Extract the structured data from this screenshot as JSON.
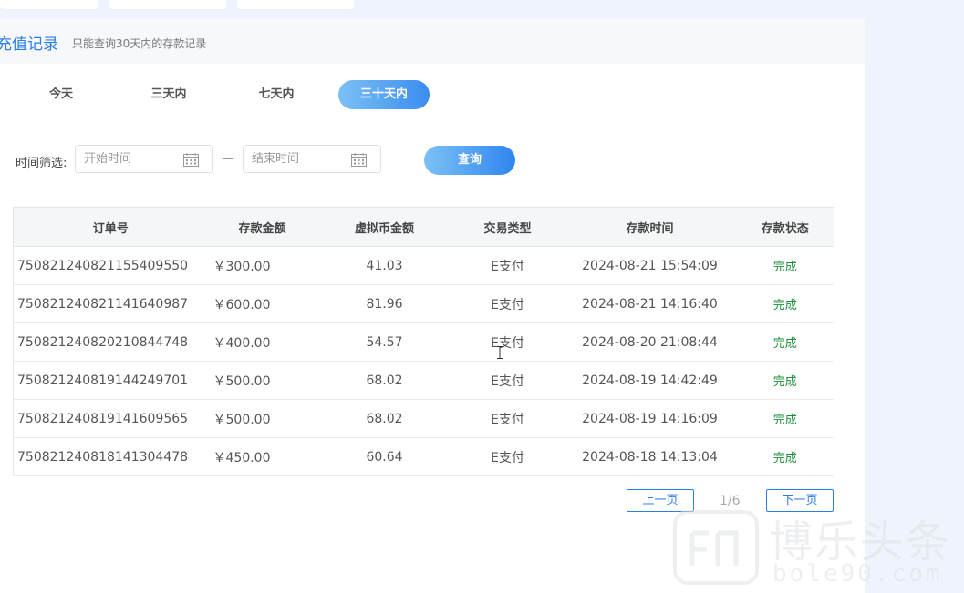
{
  "header": {
    "title": "充值记录",
    "subtitle": "只能查询30天内的存款记录"
  },
  "range_tabs": [
    {
      "label": "今天",
      "active": false
    },
    {
      "label": "三天内",
      "active": false
    },
    {
      "label": "七天内",
      "active": false
    },
    {
      "label": "三十天内",
      "active": true
    }
  ],
  "filter": {
    "label": "时间筛选:",
    "start_placeholder": "开始时间",
    "separator": "—",
    "end_placeholder": "结束时间",
    "query_label": "查询"
  },
  "table": {
    "columns": [
      "订单号",
      "存款金额",
      "虚拟币金额",
      "交易类型",
      "存款时间",
      "存款状态"
    ],
    "rows": [
      [
        "750821240821155409550",
        "￥300.00",
        "41.03",
        "E支付",
        "2024-08-21 15:54:09",
        "完成"
      ],
      [
        "750821240821141640987",
        "￥600.00",
        "81.96",
        "E支付",
        "2024-08-21 14:16:40",
        "完成"
      ],
      [
        "750821240820210844748",
        "￥400.00",
        "54.57",
        "E支付",
        "2024-08-20 21:08:44",
        "完成"
      ],
      [
        "750821240819144249701",
        "￥500.00",
        "68.02",
        "E支付",
        "2024-08-19 14:42:49",
        "完成"
      ],
      [
        "750821240819141609565",
        "￥500.00",
        "68.02",
        "E支付",
        "2024-08-19 14:16:09",
        "完成"
      ],
      [
        "750821240818141304478",
        "￥450.00",
        "60.64",
        "E支付",
        "2024-08-18 14:13:04",
        "完成"
      ]
    ]
  },
  "pagination": {
    "prev_label": "上一页",
    "page_info": "1/6",
    "next_label": "下一页"
  },
  "watermark": {
    "text": "博乐头条",
    "url": "bole90.com"
  },
  "colors": {
    "accent": "#2b7de9",
    "status_done": "#1e8f3a"
  }
}
